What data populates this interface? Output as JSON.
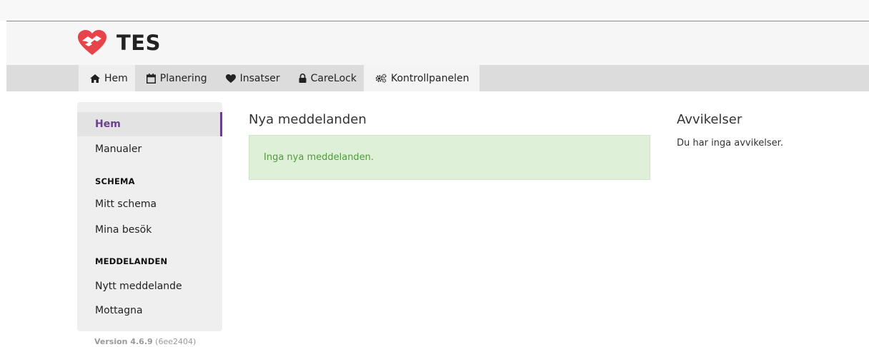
{
  "app": {
    "title": "TES",
    "brand_color": "#e8434a",
    "accent_color": "#6a3f8e"
  },
  "nav": {
    "items": [
      {
        "label": "Hem",
        "icon": "home-icon"
      },
      {
        "label": "Planering",
        "icon": "calendar-icon"
      },
      {
        "label": "Insatser",
        "icon": "heart-icon"
      },
      {
        "label": "CareLock",
        "icon": "lock-icon"
      },
      {
        "label": "Kontrollpanelen",
        "icon": "cogs-icon"
      }
    ]
  },
  "sidebar": {
    "items": [
      {
        "label": "Hem"
      },
      {
        "label": "Manualer"
      }
    ],
    "sections": [
      {
        "heading": "SCHEMA",
        "items": [
          {
            "label": "Mitt schema"
          },
          {
            "label": "Mina besök"
          }
        ]
      },
      {
        "heading": "MEDDELANDEN",
        "items": [
          {
            "label": "Nytt meddelande"
          },
          {
            "label": "Mottagna"
          }
        ]
      }
    ],
    "version": {
      "number": "Version 4.6.9",
      "build": "(6ee2404)"
    }
  },
  "messages": {
    "title": "Nya meddelanden",
    "empty_text": "Inga nya meddelanden."
  },
  "deviations": {
    "title": "Avvikelser",
    "empty_text": "Du har inga avvikelser."
  }
}
